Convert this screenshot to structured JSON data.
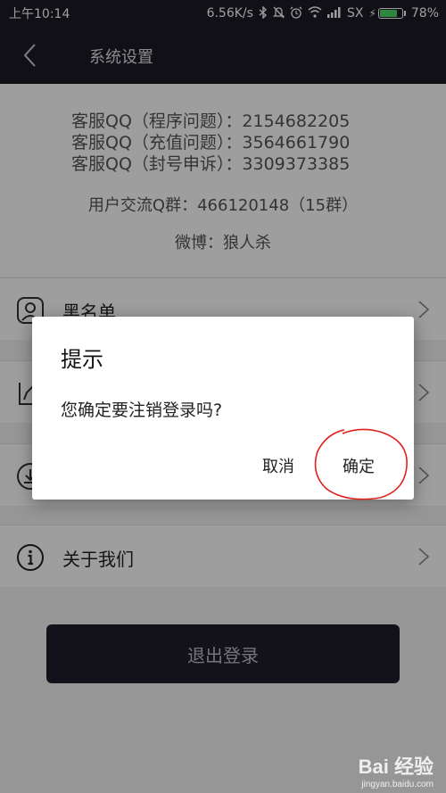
{
  "status_bar": {
    "time": "上午10:14",
    "network_speed": "6.56K/s",
    "carrier": "SX",
    "battery_percent": "78%",
    "battery_level": 0.78
  },
  "header": {
    "title": "系统设置"
  },
  "info": {
    "kf_lines": [
      "客服QQ（程序问题）：2154682205",
      "客服QQ（充值问题）：3564661790",
      "客服QQ（封号申诉）：3309373385"
    ],
    "qq_group": "用户交流Q群：466120148（15群）",
    "weibo": "微博：狼人杀"
  },
  "menu": {
    "items": [
      {
        "label": "黑名单",
        "icon": "contacts-icon"
      },
      {
        "label": "",
        "icon": "edit-icon"
      },
      {
        "label": "",
        "icon": "download-icon"
      },
      {
        "label": "关于我们",
        "icon": "info-icon"
      }
    ]
  },
  "logout": {
    "label": "退出登录"
  },
  "dialog": {
    "title": "提示",
    "message": "您确定要注销登录吗?",
    "cancel_label": "取消",
    "confirm_label": "确定"
  },
  "watermark": {
    "brand": "Bai 经验",
    "url": "jingyan.baidu.com"
  },
  "colors": {
    "header_bg": "#1b1a25",
    "battery_green": "#4cd964",
    "annotation_red": "#e0201a"
  }
}
